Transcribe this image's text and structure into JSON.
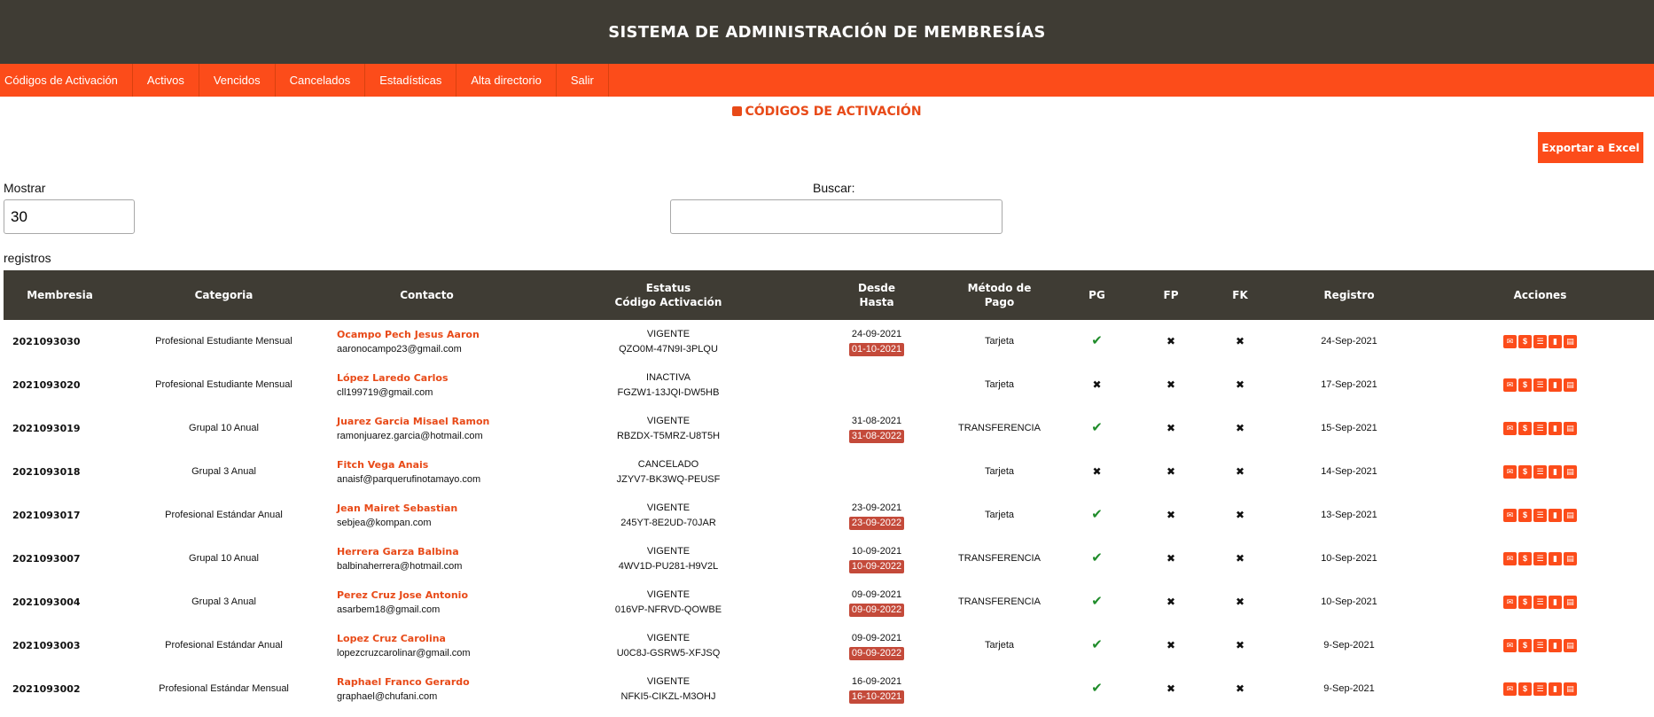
{
  "header": {
    "title": "SISTEMA DE ADMINISTRACIÓN DE MEMBRESÍAS"
  },
  "nav": [
    "Códigos de Activación",
    "Activos",
    "Vencidos",
    "Cancelados",
    "Estadísticas",
    "Alta directorio",
    "Salir"
  ],
  "page": {
    "title": "CÓDIGOS DE ACTIVACIÓN",
    "icon": "box-icon",
    "export_label": "Exportar a Excel"
  },
  "controls": {
    "mostrar_label": "Mostrar",
    "mostrar_value": "30",
    "registros_label": "registros",
    "buscar_label": "Buscar:",
    "buscar_value": ""
  },
  "table": {
    "headers": {
      "membresia": "Membresia",
      "categoria": "Categoria",
      "contacto": "Contacto",
      "estatus_line1": "Estatus",
      "estatus_line2": "Código Activación",
      "desde_line1": "Desde",
      "desde_line2": "Hasta",
      "metodo_line1": "Método de",
      "metodo_line2": "Pago",
      "pg": "PG",
      "fp": "FP",
      "fk": "FK",
      "registro": "Registro",
      "acciones": "Acciones"
    },
    "rows": [
      {
        "membresia": "2021093030",
        "categoria": "Profesional Estudiante Mensual",
        "nombre": "Ocampo Pech Jesus Aaron",
        "email": "aaronocampo23@gmail.com",
        "estatus": "VIGENTE",
        "codigo": "QZO0M-47N9I-3PLQU",
        "desde": "24-09-2021",
        "hasta": "01-10-2021",
        "metodo": "Tarjeta",
        "pg": true,
        "fp": false,
        "fk": false,
        "registro": "24-Sep-2021"
      },
      {
        "membresia": "2021093020",
        "categoria": "Profesional Estudiante Mensual",
        "nombre": "López Laredo Carlos",
        "email": "cll199719@gmail.com",
        "estatus": "INACTIVA",
        "codigo": "FGZW1-13JQI-DW5HB",
        "desde": "",
        "hasta": "",
        "metodo": "Tarjeta",
        "pg": false,
        "fp": false,
        "fk": false,
        "registro": "17-Sep-2021"
      },
      {
        "membresia": "2021093019",
        "categoria": "Grupal 10 Anual",
        "nombre": "Juarez Garcia Misael Ramon",
        "email": "ramonjuarez.garcia@hotmail.com",
        "estatus": "VIGENTE",
        "codigo": "RBZDX-T5MRZ-U8T5H",
        "desde": "31-08-2021",
        "hasta": "31-08-2022",
        "metodo": "TRANSFERENCIA",
        "pg": true,
        "fp": false,
        "fk": false,
        "registro": "15-Sep-2021"
      },
      {
        "membresia": "2021093018",
        "categoria": "Grupal 3 Anual",
        "nombre": "Fitch Vega Anais",
        "email": "anaisf@parquerufinotamayo.com",
        "estatus": "CANCELADO",
        "codigo": "JZYV7-BK3WQ-PEUSF",
        "desde": "",
        "hasta": "",
        "metodo": "Tarjeta",
        "pg": false,
        "fp": false,
        "fk": false,
        "registro": "14-Sep-2021"
      },
      {
        "membresia": "2021093017",
        "categoria": "Profesional Estándar Anual",
        "nombre": "Jean Mairet Sebastian",
        "email": "sebjea@kompan.com",
        "estatus": "VIGENTE",
        "codigo": "245YT-8E2UD-70JAR",
        "desde": "23-09-2021",
        "hasta": "23-09-2022",
        "metodo": "Tarjeta",
        "pg": true,
        "fp": false,
        "fk": false,
        "registro": "13-Sep-2021"
      },
      {
        "membresia": "2021093007",
        "categoria": "Grupal 10 Anual",
        "nombre": "Herrera Garza Balbina",
        "email": "balbinaherrera@hotmail.com",
        "estatus": "VIGENTE",
        "codigo": "4WV1D-PU281-H9V2L",
        "desde": "10-09-2021",
        "hasta": "10-09-2022",
        "metodo": "TRANSFERENCIA",
        "pg": true,
        "fp": false,
        "fk": false,
        "registro": "10-Sep-2021"
      },
      {
        "membresia": "2021093004",
        "categoria": "Grupal 3 Anual",
        "nombre": "Perez Cruz Jose Antonio",
        "email": "asarbem18@gmail.com",
        "estatus": "VIGENTE",
        "codigo": "016VP-NFRVD-QOWBE",
        "desde": "09-09-2021",
        "hasta": "09-09-2022",
        "metodo": "TRANSFERENCIA",
        "pg": true,
        "fp": false,
        "fk": false,
        "registro": "10-Sep-2021"
      },
      {
        "membresia": "2021093003",
        "categoria": "Profesional Estándar Anual",
        "nombre": "Lopez Cruz Carolina",
        "email": "lopezcruzcarolinar@gmail.com",
        "estatus": "VIGENTE",
        "codigo": "U0C8J-GSRW5-XFJSQ",
        "desde": "09-09-2021",
        "hasta": "09-09-2022",
        "metodo": "Tarjeta",
        "pg": true,
        "fp": false,
        "fk": false,
        "registro": "9-Sep-2021"
      },
      {
        "membresia": "2021093002",
        "categoria": "Profesional Estándar Mensual",
        "nombre": "Raphael Franco Gerardo",
        "email": "graphael@chufani.com",
        "estatus": "VIGENTE",
        "codigo": "NFKI5-CIKZL-M3OHJ",
        "desde": "16-09-2021",
        "hasta": "16-10-2021",
        "metodo": "",
        "pg": true,
        "fp": false,
        "fk": false,
        "registro": "9-Sep-2021"
      }
    ]
  },
  "icons": {
    "check": "check-icon",
    "cross": "cross-icon",
    "actions": [
      "mail-icon",
      "dollar-icon",
      "cart-icon",
      "trash-icon",
      "document-icon"
    ]
  },
  "colors": {
    "header_bg": "#3f3c34",
    "accent": "#fc4c1a",
    "title": "#e84a18",
    "badge": "#c44a3a",
    "check": "#1f8c2a"
  }
}
